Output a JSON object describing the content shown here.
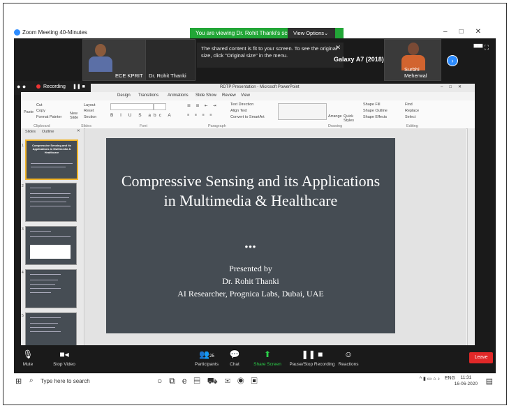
{
  "zoom": {
    "window_title": "Zoom Meeting 40-Minutes",
    "viewing_banner": "You are viewing Dr. Rohit Thanki's screen",
    "view_options": "View Options",
    "notice": "The shared content is fit to your screen. To see the original size, click \"Original size\" in the menu.",
    "participants": [
      {
        "name": "ECE KPRIT"
      },
      {
        "name": "Dr. Rohit Thanki"
      },
      {
        "name": "Galaxy A7 (2018)"
      },
      {
        "name": "Surbhi Meherwal"
      }
    ],
    "recording_label": "Recording",
    "toolbar": {
      "mute": "Mute",
      "stop_video": "Stop Video",
      "participants": "Participants",
      "participants_count": "25",
      "chat": "Chat",
      "share_screen": "Share Screen",
      "recording": "Pause/Stop Recording",
      "reactions": "Reactions",
      "leave": "Leave"
    }
  },
  "powerpoint": {
    "title": "RDTP Presentation - Microsoft PowerPoint",
    "tabs": [
      "Design",
      "Transitions",
      "Animations",
      "Slide Show",
      "Review",
      "View"
    ],
    "ribbon_groups": [
      "Clipboard",
      "Slides",
      "Font",
      "Paragraph",
      "Drawing",
      "Editing"
    ],
    "ribbon_buttons": {
      "paste": "Paste",
      "cut": "Cut",
      "copy": "Copy",
      "format_painter": "Format Painter",
      "new_slide": "New Slide",
      "layout": "Layout",
      "reset": "Reset",
      "section": "Section",
      "text_direction": "Text Direction",
      "align_text": "Align Text",
      "convert_smartart": "Convert to SmartArt",
      "arrange": "Arrange",
      "quick_styles": "Quick Styles",
      "shape_fill": "Shape Fill",
      "shape_outline": "Shape Outline",
      "shape_effects": "Shape Effects",
      "find": "Find",
      "replace": "Replace",
      "select": "Select"
    },
    "panel_tabs": [
      "Slides",
      "Outline"
    ],
    "slide_numbers": [
      "1",
      "2",
      "3",
      "4",
      "5"
    ],
    "slide": {
      "title": "Compressive Sensing and its Applications in Multimedia & Healthcare",
      "dots": "•••",
      "presented_by": "Presented by",
      "presenter": "Dr. Rohit Thanki",
      "affiliation": "AI Researcher, Prognica Labs, Dubai, UAE"
    }
  },
  "taskbar": {
    "search_placeholder": "Type here to search",
    "lang": "ENG",
    "time": "11:31",
    "date": "16-06-2020"
  }
}
